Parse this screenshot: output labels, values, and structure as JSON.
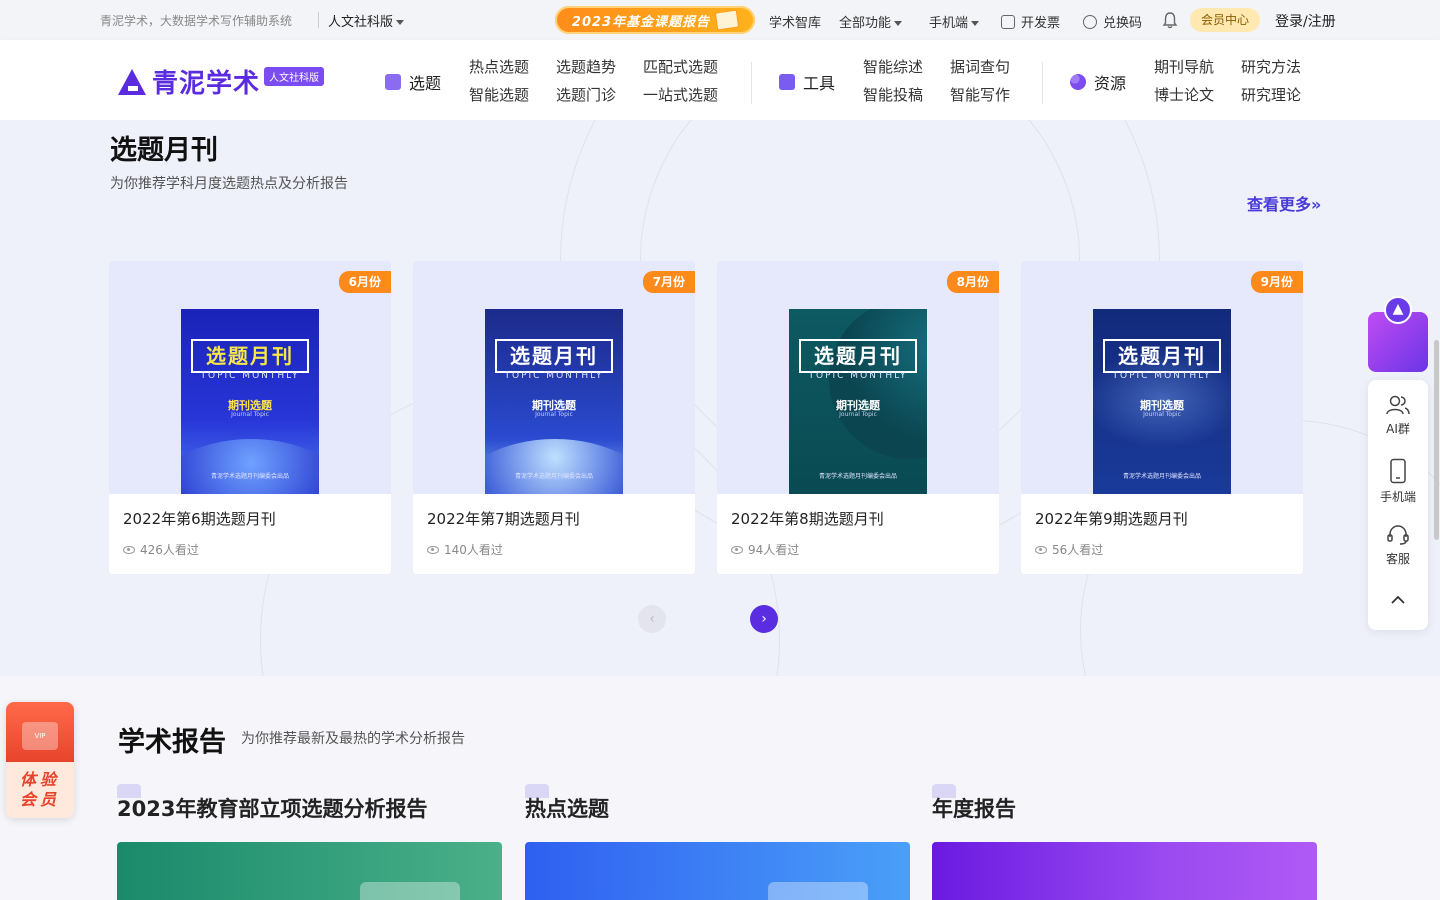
{
  "topbar": {
    "slogan": "青泥学术，大数据学术写作辅助系统",
    "edition": "人文社科版",
    "fund_banner": "2023年基金课题报告",
    "items": [
      {
        "label": "学术智库"
      },
      {
        "label": "全部功能"
      },
      {
        "label": "手机端"
      },
      {
        "label": "开发票"
      },
      {
        "label": "兑换码"
      }
    ],
    "member_center": "会员中心",
    "login": "登录/注册"
  },
  "header": {
    "logo_text": "青泥学术",
    "logo_badge": "人文社科版",
    "groups": [
      {
        "title": "选题",
        "links": [
          "热点选题",
          "选题趋势",
          "匹配式选题",
          "智能选题",
          "选题门诊",
          "一站式选题"
        ]
      },
      {
        "title": "工具",
        "links": [
          "智能综述",
          "据词查句",
          "智能投稿",
          "智能写作"
        ]
      },
      {
        "title": "资源",
        "links": [
          "期刊导航",
          "研究方法",
          "博士论文",
          "研究理论"
        ]
      }
    ]
  },
  "monthly": {
    "title": "选题月刊",
    "subtitle": "为你推荐学科月度选题热点及分析报告",
    "more": "查看更多»",
    "cover": {
      "title": "选题月刊",
      "sub": "TOPIC MONTHLY",
      "journal": "期刊选题",
      "journal_en": "Journal Topic",
      "foot": "青泥学术选题月刊编委会出品"
    },
    "cards": [
      {
        "month": "6月份",
        "name": "2022年第6期选题月刊",
        "views": "426人看过"
      },
      {
        "month": "7月份",
        "name": "2022年第7期选题月刊",
        "views": "140人看过"
      },
      {
        "month": "8月份",
        "name": "2022年第8期选题月刊",
        "views": "94人看过"
      },
      {
        "month": "9月份",
        "name": "2022年第9期选题月刊",
        "views": "56人看过"
      }
    ]
  },
  "reports": {
    "title": "学术报告",
    "subtitle": "为你推荐最新及最热的学术分析报告",
    "columns": [
      {
        "title": "2023年教育部立项选题分析报告"
      },
      {
        "title": "热点选题"
      },
      {
        "title": "年度报告"
      }
    ]
  },
  "side": {
    "items": [
      {
        "label": "AI群"
      },
      {
        "label": "手机端"
      },
      {
        "label": "客服"
      }
    ]
  },
  "vip": {
    "card_text": "VIP",
    "label_line1": "体验",
    "label_line2": "会员"
  }
}
